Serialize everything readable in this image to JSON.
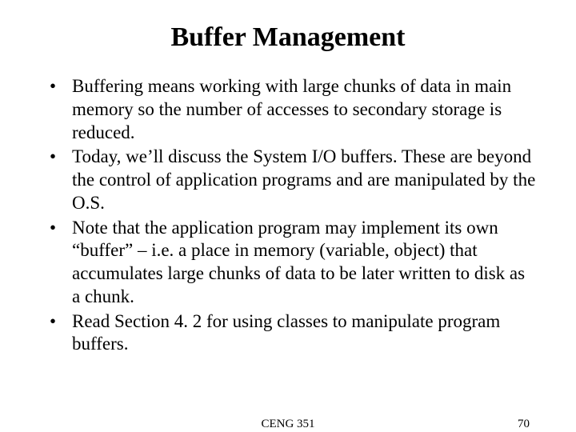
{
  "title": "Buffer Management",
  "bullets": [
    "Buffering means working with large chunks of data in main memory so the number of accesses to secondary storage is reduced.",
    "Today, we’ll discuss the System I/O buffers. These are beyond the control of application programs and are manipulated by the O.S.",
    "Note that the application program may implement its own “buffer” – i.e. a place in memory (variable, object) that accumulates large chunks of data to be later written to disk as a chunk.",
    "Read Section 4. 2 for using classes to manipulate program buffers."
  ],
  "footer": {
    "course": "CENG 351",
    "page": "70"
  }
}
